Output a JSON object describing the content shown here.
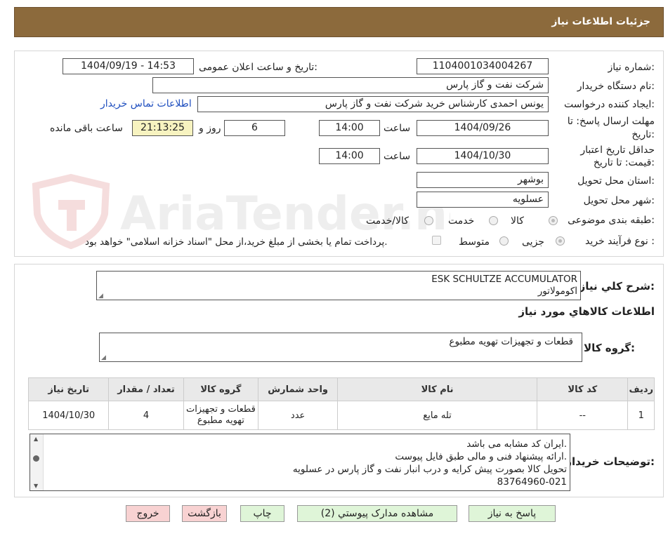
{
  "header": {
    "title": "جزئیات اطلاعات نیاز"
  },
  "form": {
    "need_number_label": "شماره نیاز:",
    "need_number": "1104001034004267",
    "announce_label": "تاریخ و ساعت اعلان عمومی:",
    "announce_value": "1404/09/19 - 14:53",
    "buyer_org_label": "نام دستگاه خریدار:",
    "buyer_org": "شرکت نفت و گاز پارس",
    "creator_label": "ایجاد کننده درخواست:",
    "creator": "یونس احمدی کارشناس خرید شرکت نفت و گاز پارس",
    "contact_link": "اطلاعات تماس خریدار",
    "deadline_label_1": "مهلت ارسال پاسخ: تا",
    "deadline_label_2": "تاریخ:",
    "deadline_date": "1404/09/26",
    "time_label": "ساعت",
    "deadline_time": "14:00",
    "days_value": "6",
    "days_label": "روز و",
    "remaining_time": "21:13:25",
    "remaining_label": "ساعت باقی مانده",
    "validity_label_1": "حداقل تاریخ اعتبار",
    "validity_label_2": "قیمت: تا تاریخ:",
    "validity_date": "1404/10/30",
    "validity_time": "14:00",
    "province_label": "استان محل تحویل:",
    "province": "بوشهر",
    "city_label": "شهر محل تحویل:",
    "city": "عسلویه",
    "category_label": "طبقه بندی موضوعی:",
    "category_options": [
      "کالا",
      "خدمت",
      "کالا/خدمت"
    ],
    "process_label": "نوع فرآیند خرید :",
    "process_options": [
      "جزیی",
      "متوسط"
    ],
    "payment_note": "پرداخت تمام یا بخشی از مبلغ خرید،از محل \"اسناد خزانه اسلامی\" خواهد بود."
  },
  "watermark": {
    "text": "AriaTender.neT"
  },
  "details": {
    "summary_label": "شرح کلي نياز:",
    "summary_line1": "ESK SCHULTZE ACCUMULATOR",
    "summary_line2": "اکومولاتور",
    "items_title": "اطلاعات کالاهاي مورد نياز",
    "group_label": "گروه کالا:",
    "group_value": "قطعات و تجهیزات تهویه مطبوع"
  },
  "table": {
    "headers": [
      "رديف",
      "کد کالا",
      "نام کالا",
      "واحد شمارش",
      "گروه کالا",
      "تعداد / مقدار",
      "تاريخ نياز"
    ],
    "rows": [
      {
        "row": "1",
        "code": "--",
        "name": "تله مایع",
        "unit": "عدد",
        "group_line1": "قطعات و تجهیزات",
        "group_line2": "تهویه مطبوع",
        "qty": "4",
        "date": "1404/10/30"
      }
    ]
  },
  "notes": {
    "label": "توضیحات خریدار:",
    "lines": [
      "ایران کد مشابه می باشد.",
      "ارائه پیشنهاد فنی و مالی طبق فایل پیوست.",
      "تحویل کالا بصورت پیش کرایه و درب انبار نفت و گاز پارس در عسلویه",
      "83764960-021"
    ]
  },
  "buttons": {
    "reply": "پاسخ به نیاز",
    "attachments": "مشاهده مدارک پیوستي (2)",
    "print": "چاپ",
    "back": "بازگشت",
    "exit": "خروج"
  }
}
